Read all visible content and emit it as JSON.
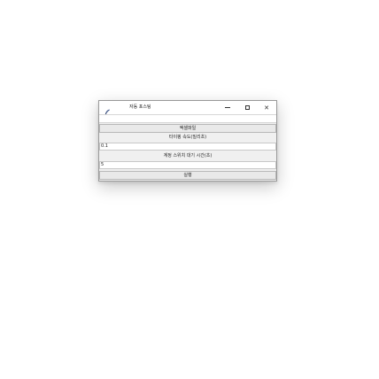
{
  "window": {
    "title": "자동 포스팅",
    "controls": {
      "minimize": "—",
      "maximize": "□",
      "close": "✕"
    }
  },
  "form": {
    "file_path_value": "",
    "excel_button_label": "엑셀파일",
    "typing_speed_label": "타이핑 속도(밀리초)",
    "typing_speed_value": "0.1",
    "account_switch_label": "계정 스위치 대기 시간(초)",
    "account_switch_value": "5",
    "run_button_label": "실행"
  },
  "icons": {
    "app": "feather-icon"
  }
}
